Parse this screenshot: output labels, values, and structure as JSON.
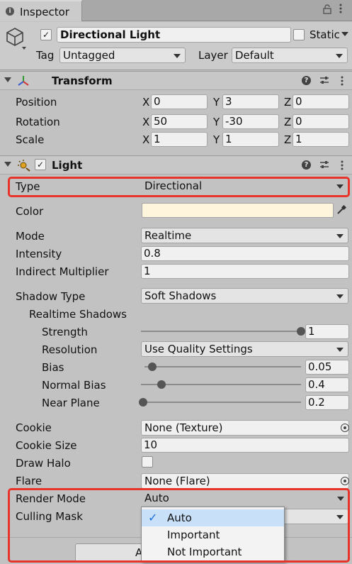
{
  "window": {
    "tab_title": "Inspector",
    "tab_icon": "info-icon",
    "lock_icon": "lock-icon",
    "menu_icon": "kebab-menu-icon"
  },
  "gameobject": {
    "active": true,
    "name": "Directional Light",
    "static_label": "Static",
    "static_checked": false,
    "tag_label": "Tag",
    "tag_value": "Untagged",
    "layer_label": "Layer",
    "layer_value": "Default"
  },
  "transform": {
    "title": "Transform",
    "rows": [
      {
        "label": "Position",
        "x": "0",
        "y": "3",
        "z": "0"
      },
      {
        "label": "Rotation",
        "x": "50",
        "y": "-30",
        "z": "0"
      },
      {
        "label": "Scale",
        "x": "1",
        "y": "1",
        "z": "1"
      }
    ],
    "axes": {
      "x": "X",
      "y": "Y",
      "z": "Z"
    }
  },
  "light": {
    "title": "Light",
    "enabled": true,
    "type_label": "Type",
    "type_value": "Directional",
    "color_label": "Color",
    "color_value": "#fff5dc",
    "mode_label": "Mode",
    "mode_value": "Realtime",
    "intensity_label": "Intensity",
    "intensity_value": "0.8",
    "indirect_label": "Indirect Multiplier",
    "indirect_value": "1",
    "shadow_type_label": "Shadow Type",
    "shadow_type_value": "Soft Shadows",
    "realtime_shadows_label": "Realtime Shadows",
    "strength_label": "Strength",
    "strength_value": "1",
    "strength_fraction": 1.0,
    "resolution_label": "Resolution",
    "resolution_value": "Use Quality Settings",
    "bias_label": "Bias",
    "bias_value": "0.05",
    "bias_fraction": 0.05,
    "normal_bias_label": "Normal Bias",
    "normal_bias_value": "0.4",
    "normal_bias_fraction": 0.13,
    "near_plane_label": "Near Plane",
    "near_plane_value": "0.2",
    "near_plane_fraction": 0.0,
    "cookie_label": "Cookie",
    "cookie_value": "None (Texture)",
    "cookie_size_label": "Cookie Size",
    "cookie_size_value": "10",
    "draw_halo_label": "Draw Halo",
    "draw_halo_checked": false,
    "flare_label": "Flare",
    "flare_value": "None (Flare)",
    "render_mode_label": "Render Mode",
    "render_mode_value": "Auto",
    "culling_mask_label": "Culling Mask"
  },
  "render_mode_popup": {
    "options": [
      {
        "label": "Auto",
        "selected": true
      },
      {
        "label": "Important",
        "selected": false
      },
      {
        "label": "Not Important",
        "selected": false
      }
    ]
  },
  "bottom_button_label": "A",
  "colors": {
    "highlight": "#e8332a",
    "panel": "#c2c2c2"
  }
}
